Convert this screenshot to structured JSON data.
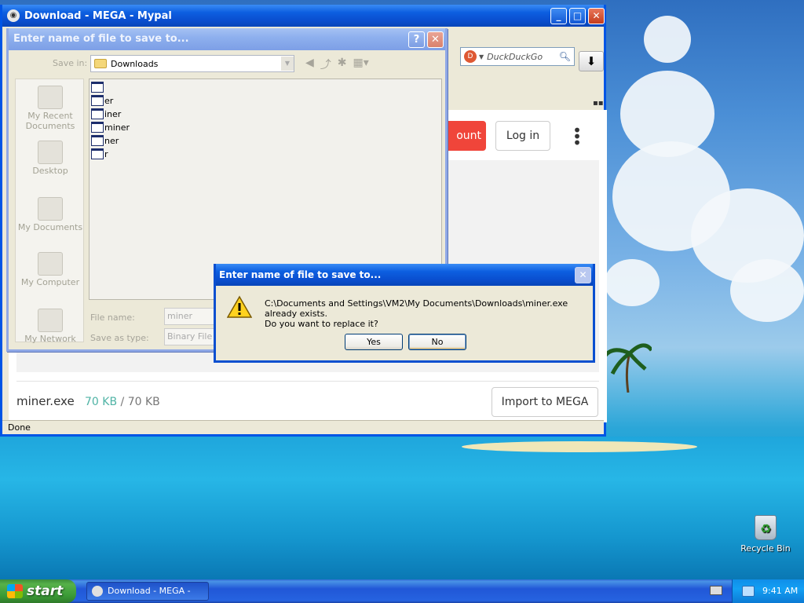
{
  "browser": {
    "title": "Download - MEGA - Mypal",
    "search_placeholder": "DuckDuckGo",
    "status": "Done",
    "page": {
      "create_label": "ount",
      "login_label": "Log in",
      "file_name": "miner.exe",
      "size_done": "70 KB",
      "size_sep": "/",
      "size_total": "70 KB",
      "import_label": "Import to MEGA"
    }
  },
  "save_dialog": {
    "title": "Enter name of file to save to...",
    "save_in_label": "Save in:",
    "save_in_value": "Downloads",
    "places": [
      "My Recent Documents",
      "Desktop",
      "My Documents",
      "My Computer",
      "My Network"
    ],
    "files": [
      "",
      "er",
      "iner",
      "miner",
      "ner",
      "r"
    ],
    "file_name_label": "File name:",
    "file_name_value": "miner",
    "save_type_label": "Save as type:",
    "save_type_value": "Binary File"
  },
  "confirm": {
    "title": "Enter name of file to save to...",
    "line1": "C:\\Documents and Settings\\VM2\\My Documents\\Downloads\\miner.exe already exists.",
    "line2": "Do you want to replace it?",
    "yes": "Yes",
    "no": "No"
  },
  "desktop": {
    "recycle_bin": "Recycle Bin"
  },
  "taskbar": {
    "start": "start",
    "task": "Download - MEGA - M...",
    "clock": "9:41 AM"
  },
  "colors": {
    "xp_blue": "#0a4fd0",
    "mega_red": "#f0453a",
    "progress_teal": "#4fb3a5"
  }
}
